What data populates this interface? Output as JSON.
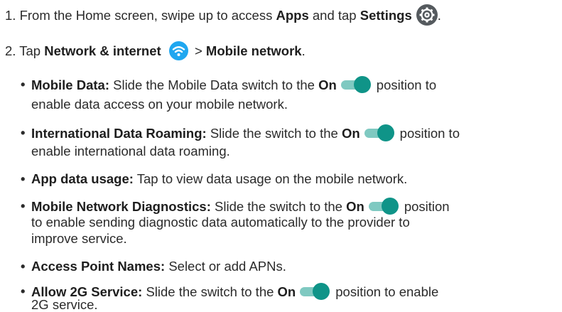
{
  "step1": {
    "num": "1.",
    "text_a": "From the Home screen, swipe up to access",
    "apps": "Apps",
    "text_b": "and tap",
    "settings": "Settings",
    "end": "."
  },
  "step2": {
    "num": "2.",
    "tap": "Tap",
    "network": "Network & internet",
    "arrow": ">",
    "mobile": "Mobile network",
    "end": "."
  },
  "items": [
    {
      "title": "Mobile Data:",
      "line1_a": "Slide the Mobile Data switch to the",
      "on": "On",
      "line1_b": "position to",
      "line2": "enable data access on your mobile network."
    },
    {
      "title": "International Data Roaming:",
      "line1_a": "Slide the switch to the",
      "on": "On",
      "line1_b": "position to",
      "line2": "enable international data roaming."
    },
    {
      "title": "App data usage:",
      "line1_a": "Tap to view data usage on the mobile network."
    },
    {
      "title": "Mobile Network Diagnostics:",
      "line1_a": "Slide the switch to the",
      "on": "On",
      "line1_b": "position",
      "line2": "to enable sending diagnostic data automatically to the provider to",
      "line3": "improve service."
    },
    {
      "title": "Access Point Names:",
      "line1_a": "Select or add APNs."
    },
    {
      "title": "Allow 2G Service:",
      "line1_a": "Slide the switch to the",
      "on": "On",
      "line1_b": "position to enable",
      "line2": "2G service."
    }
  ],
  "bullet": "•",
  "icons": {
    "settings": "settings-gear-icon",
    "wifi": "wifi-icon",
    "toggle": "toggle-on-icon"
  },
  "colors": {
    "toggle_knob": "#0f9488",
    "toggle_track": "#7fc9c1",
    "settings_icon_bg": "#555a5e",
    "wifi_icon_bg": "#20a7f0"
  }
}
